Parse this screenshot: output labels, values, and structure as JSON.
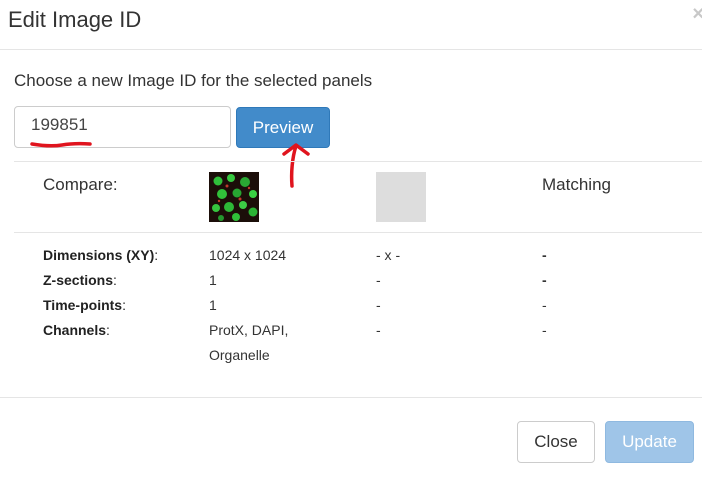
{
  "dialog": {
    "title": "Edit Image ID",
    "close_glyph": "×"
  },
  "form": {
    "instruction": "Choose a new Image ID for the selected panels",
    "image_id_value": "199851",
    "preview_label": "Preview"
  },
  "compare": {
    "compare_label": "Compare:",
    "matching_label": "Matching"
  },
  "rows": [
    {
      "label": "Dimensions (XY)",
      "suffix": ":",
      "current": "1024 x 1024",
      "preview": "- x -",
      "matching": "-"
    },
    {
      "label": "Z-sections",
      "suffix": ":",
      "current": "1",
      "preview": "-",
      "matching": "-"
    },
    {
      "label": "Time-points",
      "suffix": ":",
      "current": "1",
      "preview": "-",
      "matching": "-"
    },
    {
      "label": "Channels",
      "suffix": ":",
      "current": "ProtX, DAPI,",
      "current_line2": "Organelle",
      "preview": "-",
      "matching": "-"
    }
  ],
  "footer": {
    "close_label": "Close",
    "update_label": "Update"
  },
  "colors": {
    "primary": "#428bca",
    "primary_disabled": "#9fc5e8",
    "annotation_red": "#e0141e",
    "thumb_green": "#2ecc40"
  }
}
